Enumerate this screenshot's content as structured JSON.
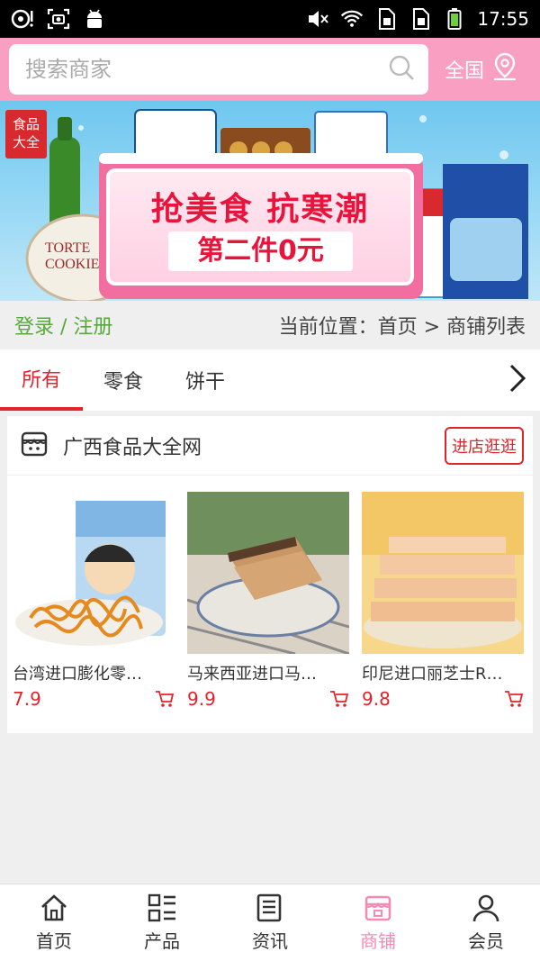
{
  "status_bar": {
    "time": "17:55",
    "left_icons": [
      "media-icon",
      "screenshot-icon",
      "android-icon"
    ],
    "right_icons": [
      "mute-icon",
      "wifi-icon",
      "sim1-icon",
      "sim2-icon",
      "battery-icon"
    ]
  },
  "header": {
    "search_placeholder": "搜索商家",
    "region_label": "全国",
    "bg_color": "#f9a0c2"
  },
  "banner": {
    "tag_line1": "食品",
    "tag_line2": "大全",
    "headline": "抢美食 抗寒潮",
    "subline": "第二件0元"
  },
  "nav": {
    "login_link": "登录 / 注册",
    "location_label": "当前位置：首页 > 商铺列表"
  },
  "tabs": [
    {
      "label": "所有",
      "active": true
    },
    {
      "label": "零食",
      "active": false
    },
    {
      "label": "饼干",
      "active": false
    }
  ],
  "shop": {
    "name": "广西食品大全网",
    "visit_button": "进店逛逛",
    "products": [
      {
        "name": "台湾进口膨化零…",
        "price": "7.9"
      },
      {
        "name": "马来西亚进口马…",
        "price": "9.9"
      },
      {
        "name": "印尼进口丽芝士R…",
        "price": "9.8"
      }
    ]
  },
  "bottom_nav": [
    {
      "label": "首页",
      "icon": "home-icon",
      "active": false
    },
    {
      "label": "产品",
      "icon": "grid-list-icon",
      "active": false
    },
    {
      "label": "资讯",
      "icon": "news-icon",
      "active": false
    },
    {
      "label": "商铺",
      "icon": "store-icon",
      "active": true
    },
    {
      "label": "会员",
      "icon": "user-icon",
      "active": false
    }
  ],
  "colors": {
    "accent": "#e2232b",
    "brand_pink": "#f9a0c2",
    "active_nav": "#f28cb4",
    "login_green": "#58a93c"
  }
}
